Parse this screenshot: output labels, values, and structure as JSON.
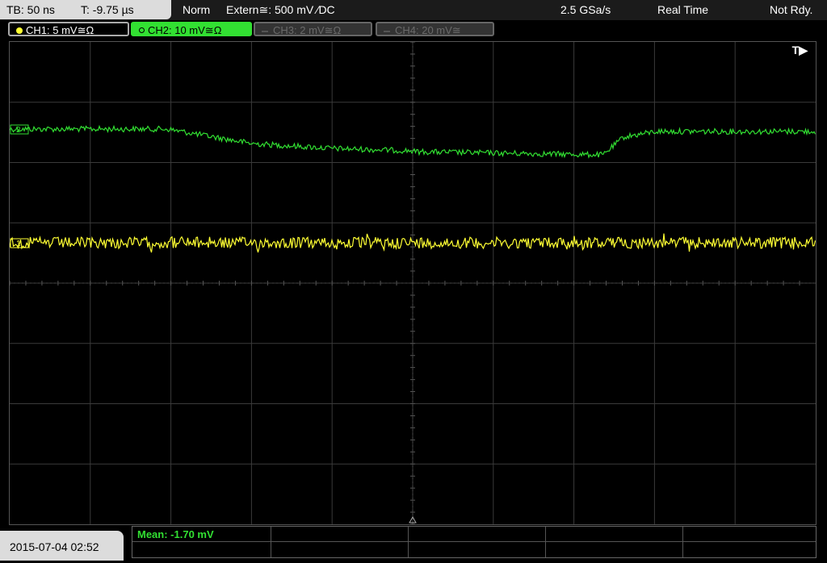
{
  "topbar": {
    "timebase": "TB: 50 ns",
    "trigger_time": "T: -9.75 µs",
    "trigger_mode": "Norm",
    "trigger_source": "Extern≅: 500 mV ∕DC",
    "sample_rate": "2.5 GSa/s",
    "acq_mode": "Real Time",
    "status": "Not Rdy."
  },
  "channels": [
    {
      "label": "CH1: 5 mV≅Ω",
      "color": "#ffff33",
      "state": "on"
    },
    {
      "label": "CH2: 10 mV≅Ω",
      "color": "#32e032",
      "state": "selected"
    },
    {
      "label": "CH3: 2 mV≅Ω",
      "color": "#6a6a6a",
      "state": "off"
    },
    {
      "label": "CH4: 20 mV≅",
      "color": "#6a6a6a",
      "state": "off"
    }
  ],
  "scope": {
    "trigger_marker": "T▶",
    "ch1_marker": "1",
    "ch2_marker": "2",
    "colors": {
      "grid": "#3a3a3a",
      "ch1": "#ffff33",
      "ch2": "#32e032",
      "background": "#000000"
    }
  },
  "footer": {
    "datetime": "2015-07-04 02:52",
    "measurement": "Mean: -1.70 mV"
  }
}
